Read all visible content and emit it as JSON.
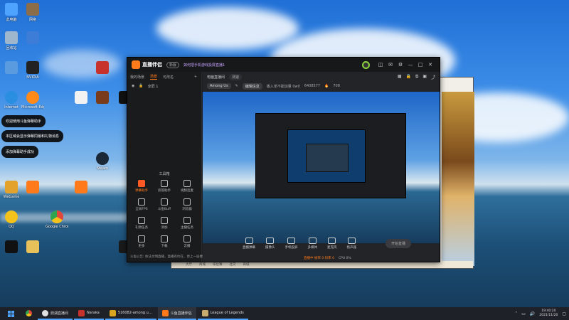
{
  "desktop": {
    "icons": [
      {
        "label": "此电脑",
        "color": "#4ea3ff"
      },
      {
        "label": "网络",
        "color": "#3d7dd8"
      },
      {
        "label": "回收站",
        "color": "#9fb7cc"
      },
      {
        "label": "Internet",
        "color": "#2a8fe0"
      },
      {
        "label": "Microsoft Edge",
        "color": "#1ea1a8"
      },
      {
        "label": "Steam",
        "color": "#1b2838"
      },
      {
        "label": "WeGame",
        "color": "#e3a22b"
      },
      {
        "label": "Google Chrome",
        "color": "#e2463a"
      },
      {
        "label": "QQ",
        "color": "#f3c21b"
      },
      {
        "label": "NVIDIA",
        "color": "#76b900"
      }
    ],
    "toasts": [
      "欢迎使用斗鱼弹幕助手",
      "本区域会显示弹幕同最和礼物消息",
      "添加弹幕助手成功"
    ]
  },
  "app": {
    "title": "直播伴侣",
    "version": "新版",
    "notice": "如何把手机游戏投屏直播1",
    "window_controls": [
      "—",
      "□",
      "✕"
    ],
    "left_tabs": [
      {
        "label": "我的场景",
        "active": false
      },
      {
        "label": "场景",
        "active": true
      },
      {
        "label": "可改名",
        "active": false
      }
    ],
    "scene_item": "全屏 1",
    "tools_title": "工具箱",
    "tools": [
      {
        "label": "弹幕助手",
        "hot": true
      },
      {
        "label": "房管助手",
        "hot": false
      },
      {
        "label": "视频连麦",
        "hot": false
      },
      {
        "label": "全局FPS",
        "hot": false
      },
      {
        "label": "斗鱼Buff",
        "hot": false
      },
      {
        "label": "浏览器",
        "hot": false
      },
      {
        "label": "礼物任务",
        "hot": false
      },
      {
        "label": "添加",
        "hot": false
      },
      {
        "label": "主播任务",
        "hot": false
      },
      {
        "label": "更多",
        "hot": false
      },
      {
        "label": "下载",
        "hot": false
      },
      {
        "label": "云播",
        "hot": false
      }
    ],
    "footer": "斗鱼公告: 依法文明直播，直播有约在，更上一层楼",
    "room": {
      "tab1": "电脑直播间",
      "tab2": "测速"
    },
    "sub": {
      "game": "Among Us",
      "edit": "编辑信息",
      "hint": "版入单不能加量 0w0",
      "fans": "6408577",
      "hot": "708"
    },
    "controls": [
      {
        "label": "直播弹幕"
      },
      {
        "label": "摄像头"
      },
      {
        "label": "手机投屏"
      },
      {
        "label": "多媒体"
      },
      {
        "label": "麦克风"
      },
      {
        "label": "扬声器"
      }
    ],
    "start_label": "开始直播",
    "status": {
      "main": "直播中 帧率 0 码率 0",
      "extra": "CPU 0%"
    }
  },
  "game_window": {
    "bottom_items": [
      "大厅",
      "商城",
      "排位赛",
      "社交",
      "商城"
    ]
  },
  "taskbar": {
    "items": [
      {
        "label": "鼎湖直播间",
        "color": "#e0e0e0",
        "active": false,
        "running": true
      },
      {
        "label": "Naraka",
        "color": "#c8322c",
        "active": false,
        "running": true
      },
      {
        "label": "516082-among u...",
        "color": "#d9a520",
        "active": false,
        "running": true
      },
      {
        "label": "斗鱼直播伴侣",
        "color": "#ff7a1a",
        "active": true,
        "running": true
      },
      {
        "label": "League of Legends",
        "color": "#c8aa6e",
        "active": false,
        "running": true
      }
    ],
    "time": "19:40:20",
    "date": "2021/11/20"
  }
}
